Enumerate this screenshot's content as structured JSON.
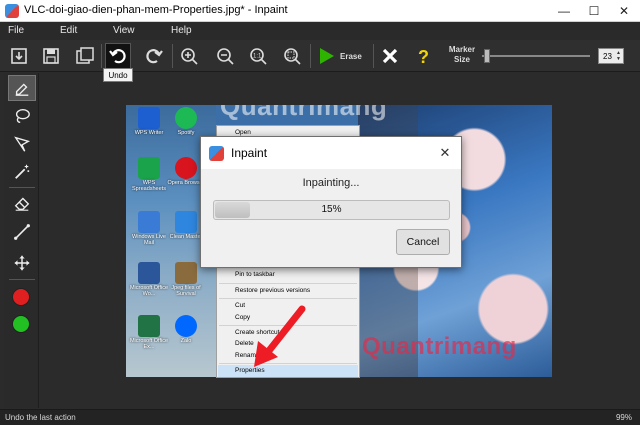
{
  "window": {
    "title": "VLC-doi-giao-dien-phan-mem-Properties.jpg* - Inpaint",
    "minimize_glyph": "—",
    "maximize_glyph": "☐",
    "close_glyph": "✕"
  },
  "menu": [
    "File",
    "Edit",
    "View",
    "Help"
  ],
  "toolbar": {
    "erase_label": "Erase",
    "marker_label_1": "Marker",
    "marker_label_2": "Size",
    "marker_size_value": "23",
    "marker_size_fraction": 0.02,
    "tooltip": "Undo",
    "icons": [
      "open-file-icon",
      "save-icon",
      "save-as-icon",
      "undo-icon",
      "redo-icon",
      "zoom-in-icon",
      "zoom-out-icon",
      "zoom-actual-icon",
      "zoom-fit-icon",
      "erase-play-icon",
      "cancel-x-icon",
      "help-question-icon"
    ]
  },
  "left_tools": [
    "marker-icon",
    "lasso-icon",
    "polygon-lasso-icon",
    "magic-wand-icon",
    "eraser-icon",
    "line-icon",
    "move-icon"
  ],
  "colors": {
    "accent_green": "#2db300",
    "cancel_white": "#ffffff",
    "help_yellow": "#f5d400",
    "color_red": "#e02020",
    "color_green": "#22c022"
  },
  "canvas": {
    "desktop_icons": [
      {
        "caption": "WPS Writer",
        "color": "#1d5fd1"
      },
      {
        "caption": "Spotify",
        "color": "#1db954"
      },
      {
        "caption": "WPS Spreadsheets",
        "color": "#1aa34a"
      },
      {
        "caption": "Opera Browser",
        "color": "#d8141f"
      },
      {
        "caption": "Windows Live Mail",
        "color": "#3a7bd5"
      },
      {
        "caption": "Clean Master",
        "color": "#2e86de"
      },
      {
        "caption": "Microsoft Office Wo...",
        "color": "#2b579a"
      },
      {
        "caption": "Jpeg files of Survival",
        "color": "#8a6b3e"
      },
      {
        "caption": "Microsoft Office Ex...",
        "color": "#217346"
      },
      {
        "caption": "Zalo",
        "color": "#0068ff"
      }
    ],
    "context_menu": [
      "Open",
      "Pin to taskbar",
      "Restore previous versions",
      "Cut",
      "Copy",
      "Create shortcut",
      "Delete",
      "Rename",
      "Properties"
    ],
    "watermark": "Quantrimang"
  },
  "dialog": {
    "title": "Inpaint",
    "close_glyph": "✕",
    "status": "Inpainting...",
    "progress_text": "15%",
    "progress_fraction": 0.15,
    "cancel_label": "Cancel"
  },
  "statusbar": {
    "message": "Undo the last action",
    "zoom": "99%"
  }
}
